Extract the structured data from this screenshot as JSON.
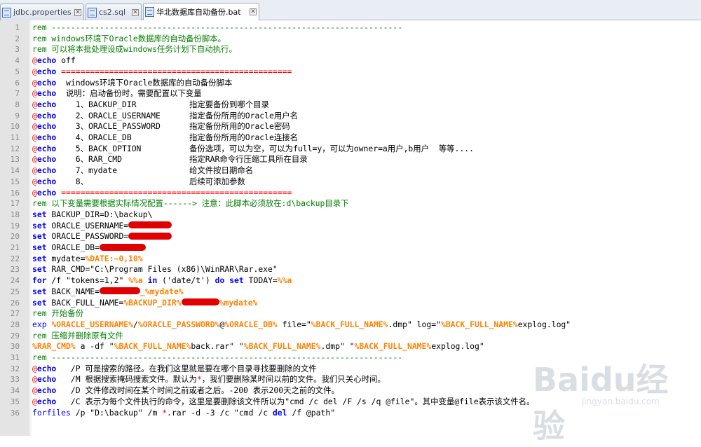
{
  "tabs": [
    {
      "label": "jdbc.properties",
      "active": false
    },
    {
      "label": "cs2.sql",
      "active": false
    },
    {
      "label": "华北数据库自动备份.bat",
      "active": true
    }
  ],
  "lines": {
    "1": {
      "n": "1",
      "a": "rem -------------------------------------------------------------------------"
    },
    "2": {
      "n": "2",
      "a": "rem windows环境下Oracle数据库的自动备份脚本。"
    },
    "3": {
      "n": "3",
      "a": "rem 可以将本批处理设成windows任务计划下自动执行。"
    },
    "4": {
      "n": "4",
      "at": "@",
      "kw": "echo",
      "b": " off"
    },
    "5": {
      "n": "5",
      "at": "@",
      "kw": "echo",
      "cm": " ================================================"
    },
    "6": {
      "n": "6",
      "at": "@",
      "kw": "echo",
      "b": "  windows环境下Oracle数据库的自动备份脚本"
    },
    "7": {
      "n": "7",
      "at": "@",
      "kw": "echo",
      "b": "  说明：启动备份时，需要配置以下变量"
    },
    "8": {
      "n": "8",
      "at": "@",
      "kw": "echo",
      "b": "    1、BACKUP_DIR           指定要备份到哪个目录"
    },
    "9": {
      "n": "9",
      "at": "@",
      "kw": "echo",
      "b": "    2、ORACLE_USERNAME      指定备份所用的Oracle用户名"
    },
    "10": {
      "n": "10",
      "at": "@",
      "kw": "echo",
      "b": "    3、ORACLE_PASSWORD      指定备份所用的Oracle密码"
    },
    "11": {
      "n": "11",
      "at": "@",
      "kw": "echo",
      "b": "    4、ORACLE_DB            指定备份所用的Oracle连接名"
    },
    "12": {
      "n": "12",
      "at": "@",
      "kw": "echo",
      "b": "    5、BACK_OPTION          备份选项，可以为空，可以为full=y，可以为owner=a用户,b用户  等等...."
    },
    "13": {
      "n": "13",
      "at": "@",
      "kw": "echo",
      "b": "    6、RAR_CMD              指定RAR命令行压缩工具所在目录"
    },
    "14": {
      "n": "14",
      "at": "@",
      "kw": "echo",
      "b": "    7、mydate               给文件按日期命名"
    },
    "15": {
      "n": "15",
      "at": "@",
      "kw": "echo",
      "b": "    8、                     后续可添加参数"
    },
    "16": {
      "n": "16",
      "at": "@",
      "kw": "echo",
      "cm": " ================================================"
    },
    "17": {
      "n": "17",
      "a": "rem 以下变量需要根据实际情况配置------> 注意：此脚本必须放在:d\\backup目录下"
    },
    "18": {
      "n": "18",
      "kw": "set",
      "b": " BACKUP_DIR=D:\\backup\\"
    },
    "19": {
      "n": "19",
      "kw": "set",
      "b": " ORACLE_USERNAME="
    },
    "20": {
      "n": "20",
      "kw": "set",
      "b": " ORACLE_PASSWORD="
    },
    "21": {
      "n": "21",
      "kw": "set",
      "b": " ORACLE_DB="
    },
    "22": {
      "n": "22",
      "kw": "set",
      "b": " mydate=",
      "v": "%DATE:~0,10%"
    },
    "23": {
      "n": "23",
      "kw": "set",
      "b": " RAR_CMD=\"C:\\Program Files (x86)\\WinRAR\\Rar.exe\""
    },
    "24": {
      "n": "24",
      "kw": "for",
      "b": " /f \"tokens=1,2\" ",
      "v": "%%a",
      "k2": " in",
      "c": " ('date/t') ",
      "k3": "do",
      "d": " ",
      "k4": "set",
      "e": " TODAY=",
      "v2": "%%a"
    },
    "25": {
      "n": "25",
      "kw": "set",
      "b": " BACK_NAME=",
      "v": "_%mydate%"
    },
    "26": {
      "n": "26",
      "kw": "set",
      "b": " BACK_FULL_NAME=",
      "v": "%BACKUP_DIR%",
      "v2": "%mydate%"
    },
    "27": {
      "n": "27",
      "a": "rem 开始备份"
    },
    "28": {
      "n": "28",
      "k5": "exp",
      "b": " ",
      "v": "%ORACLE_USERNAME%",
      "c": "/",
      "v2": "%ORACLE_PASSWORD%",
      "d": "@",
      "v3": "%ORACLE_DB%",
      "e": " file=\"",
      "v4": "%BACK_FULL_NAME%",
      "f": ".dmp\" log=\"",
      "v5": "%BACK_FULL_NAME%",
      "g": "explog.log\""
    },
    "29": {
      "n": "29",
      "a": "rem 压缩并删除原有文件"
    },
    "30": {
      "n": "30",
      "v": "%RAR_CMD%",
      "b": " a -df \"",
      "v2": "%BACK_FULL_NAME%",
      "c": "back.rar\" \"",
      "v3": "%BACK_FULL_NAME%",
      "d": ".dmp\" \"",
      "v4": "%BACK_FULL_NAME%",
      "e": "explog.log\""
    },
    "31": {
      "n": "31",
      "a": "rem -------------------------------------------------------------------------"
    },
    "32": {
      "n": "32",
      "at": "@",
      "kw": "echo",
      "b": "   /P 可是搜索的路径。在我们这里就是要在哪个目录寻找要删除的文件"
    },
    "33": {
      "n": "33",
      "at": "@",
      "kw": "echo",
      "b": "   /M 根据搜索掩码搜索文件。默认为",
      "r": "*",
      "c": "，我们要删除某时间以前的文件。我们只关心时间。"
    },
    "34": {
      "n": "34",
      "at": "@",
      "kw": "echo",
      "b": "   /D 文件修改时间在某个时间之前或者之后。-200 表示200天之前的文件。"
    },
    "35": {
      "n": "35",
      "at": "@",
      "kw": "echo",
      "b": "   /C 表示为每个文件执行的命令，这里是要删除该文件所以为\"cmd /c del /F /s /q @file\"。其中变量@file表示该文件名。"
    },
    "36": {
      "n": "36",
      "k5": "forfiles",
      "b": " /p \"D:\\backup\" /m ",
      "r": "*",
      "c": ".rar -d -3 /c \"cmd /c ",
      "k6": "del",
      "d": " /f @path\""
    }
  },
  "watermark": {
    "logo": "Baidu经验",
    "sub": "jingyan.baidu.com"
  },
  "colors": {
    "keyword": "#0000ff",
    "comment": "#008000",
    "variable": "#ff8000",
    "redaction": "#e00000"
  }
}
